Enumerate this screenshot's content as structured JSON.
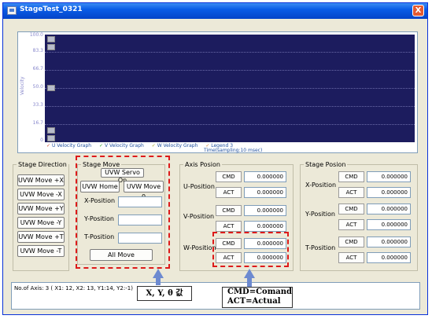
{
  "window": {
    "title": "StageTest_0321",
    "close_label": "X"
  },
  "graph": {
    "y_ticks": [
      "100.0",
      "83.3",
      "66.7",
      "50.0",
      "33.3",
      "16.7",
      "0"
    ],
    "y_title": "Velocity",
    "legend": [
      "U Velocity Graph",
      "V Velocity Graph",
      "W Velocity Graph",
      "Legend 3"
    ],
    "x_title": "Time(sampling:10 msec)"
  },
  "stage_direction": {
    "title": "Stage Direction",
    "buttons": [
      "UVW Move +X",
      "UVW Move -X",
      "UVW Move +Y",
      "UVW Move -Y",
      "UVW Move +T",
      "UVW Move -T"
    ]
  },
  "stage_move": {
    "title": "Stage Move",
    "servo_label": "UVW Servo On",
    "home_label": "UVW Home",
    "move0_label": "UVW Move 0",
    "x_label": "X-Position",
    "y_label": "Y-Position",
    "t_label": "T-Position",
    "x_value": "",
    "y_value": "",
    "t_value": "",
    "all_move_label": "All Move"
  },
  "axis_position": {
    "title": "Axis Posion",
    "rows": [
      {
        "label": "U-Position",
        "cmd": "0.000000",
        "act": "0.000000"
      },
      {
        "label": "V-Position",
        "cmd": "0.000000",
        "act": "0.000000"
      },
      {
        "label": "W-Position",
        "cmd": "0.000000",
        "act": "0.000000"
      }
    ],
    "cmd_tag": "CMD",
    "act_tag": "ACT"
  },
  "stage_position": {
    "title": "Stage Posion",
    "rows": [
      {
        "label": "X-Position",
        "cmd": "0.000000",
        "act": "0.000000"
      },
      {
        "label": "Y-Position",
        "cmd": "0.000000",
        "act": "0.000000"
      },
      {
        "label": "T-Position",
        "cmd": "0.000000",
        "act": "0.000000"
      }
    ],
    "cmd_tag": "CMD",
    "act_tag": "ACT"
  },
  "status_text": "No.of Axis: 3 ( X1: 12, X2: 13, Y1:14, Y2:-1)",
  "callouts": {
    "xyt": "X, Y, θ 값",
    "cmd_line": "CMD=Comand",
    "act_line": "ACT=Actual"
  }
}
